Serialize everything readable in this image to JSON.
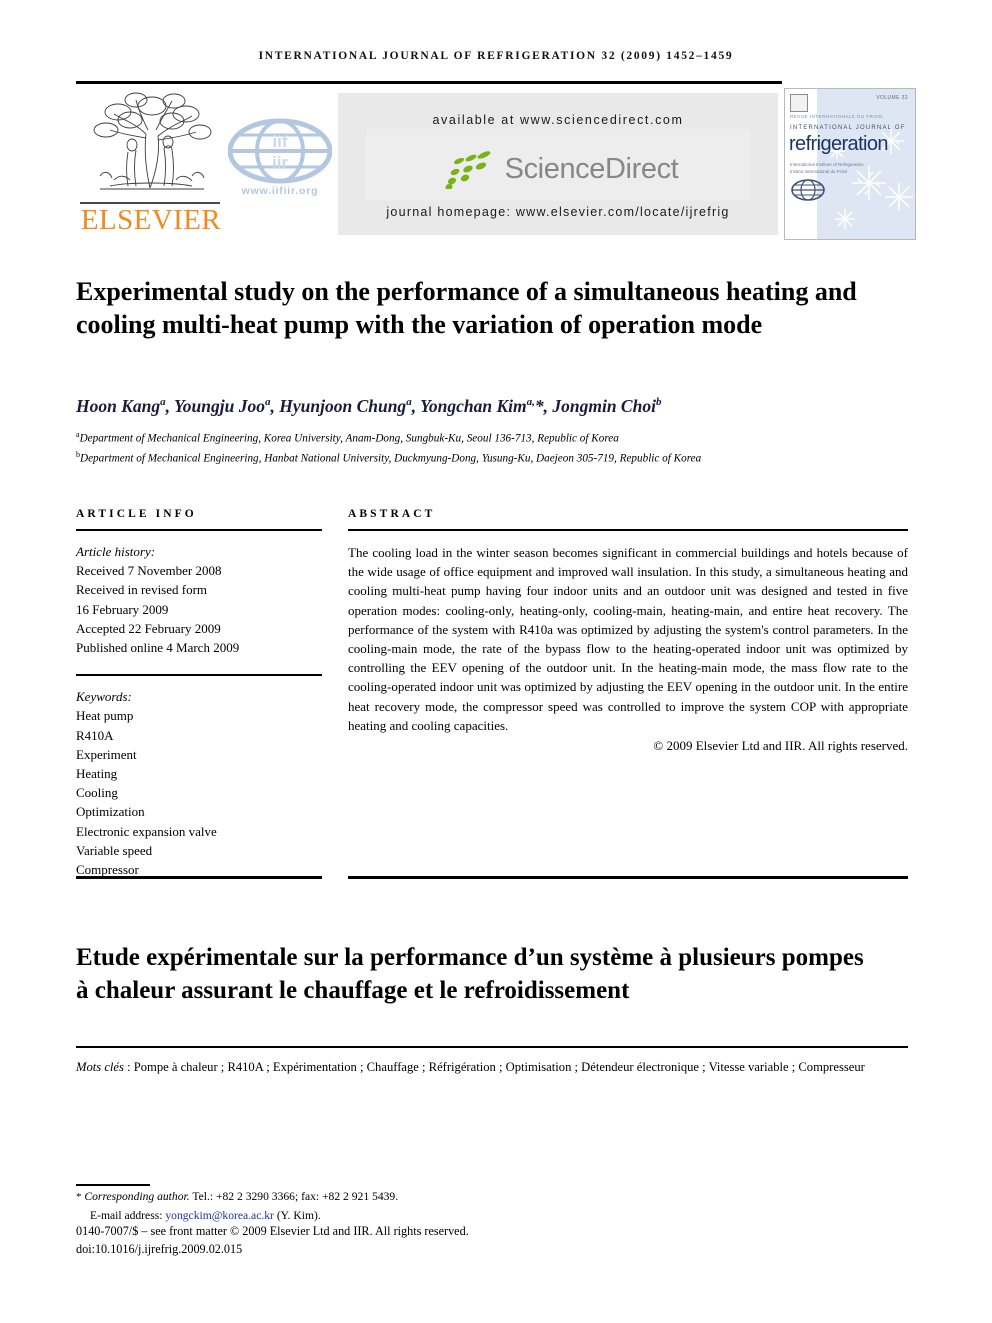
{
  "running_head": "International Journal of Refrigeration 32 (2009) 1452–1459",
  "header": {
    "elsevier_wordmark": "ELSEVIER",
    "iir_url": "www.iifiir.org",
    "iir_top_text": "iif",
    "iir_bottom_text": "iir",
    "available_at": "available at www.sciencedirect.com",
    "sciencedirect_wordmark": "ScienceDirect",
    "journal_homepage": "journal homepage: www.elsevier.com/locate/ijrefrig",
    "cover": {
      "volume": "VOLUME 32",
      "eyebrow": "REVUE INTERNATIONALE DU FROID",
      "kicker": "INTERNATIONAL JOURNAL OF",
      "title": "refrigeration",
      "subtitle_line1": "International Institute of Refrigeration",
      "subtitle_line2": "Institut International du Froid"
    }
  },
  "article": {
    "title": "Experimental study on the performance of a simultaneous heating and cooling multi-heat pump with the variation of operation mode",
    "authors_html": "Hoon Kang<sup>a</sup>, Youngju Joo<sup>a</sup>, Hyunjoon Chung<sup>a</sup>, Yongchan Kim<sup>a,</sup>*, Jongmin Choi<sup>b</sup>",
    "affiliation_a": "Department of Mechanical Engineering, Korea University, Anam-Dong, Sungbuk-Ku, Seoul 136-713, Republic of Korea",
    "affiliation_b": "Department of Mechanical Engineering, Hanbat National University, Duckmyung-Dong, Yusung-Ku, Daejeon 305-719, Republic of Korea"
  },
  "article_info": {
    "heading": "ARTICLE INFO",
    "history_label": "Article history:",
    "history": [
      "Received 7 November 2008",
      "Received in revised form",
      "16 February 2009",
      "Accepted 22 February 2009",
      "Published online 4 March 2009"
    ],
    "keywords_label": "Keywords:",
    "keywords": [
      "Heat pump",
      "R410A",
      "Experiment",
      "Heating",
      "Cooling",
      "Optimization",
      "Electronic expansion valve",
      "Variable speed",
      "Compressor"
    ]
  },
  "abstract": {
    "heading": "ABSTRACT",
    "text": "The cooling load in the winter season becomes significant in commercial buildings and hotels because of the wide usage of office equipment and improved wall insulation. In this study, a simultaneous heating and cooling multi-heat pump having four indoor units and an outdoor unit was designed and tested in five operation modes: cooling-only, heating-only, cooling-main, heating-main, and entire heat recovery. The performance of the system with R410a was optimized by adjusting the system's control parameters. In the cooling-main mode, the rate of the bypass flow to the heating-operated indoor unit was optimized by controlling the EEV opening of the outdoor unit. In the heating-main mode, the mass flow rate to the cooling-operated indoor unit was optimized by adjusting the EEV opening in the outdoor unit. In the entire heat recovery mode, the compressor speed was controlled to improve the system COP with appropriate heating and cooling capacities.",
    "copyright": "© 2009 Elsevier Ltd and IIR. All rights reserved."
  },
  "french": {
    "title": "Etude expérimentale sur la performance d’un système à plusieurs pompes à chaleur assurant le chauffage et le refroidissement",
    "keywords_label": "Mots clés",
    "keywords_text": " : Pompe à chaleur ; R410A ; Expérimentation ; Chauffage ; Réfrigération ; Optimisation ; Détendeur électronique ; Vitesse variable ; Compresseur"
  },
  "footer": {
    "corresponding_label": "Corresponding author.",
    "corresponding_contact": " Tel.: +82 2 3290 3366; fax: +82 2 921 5439.",
    "email_label": "E-mail address:",
    "email": "yongckim@korea.ac.kr",
    "email_suffix": "(Y. Kim).",
    "front_matter": "0140-7007/$ – see front matter © 2009 Elsevier Ltd and IIR. All rights reserved.",
    "doi": "doi:10.1016/j.ijrefrig.2009.02.015"
  },
  "colors": {
    "elsevier_orange": "#F08A21",
    "sciencedirect_green": "#7AB317",
    "sciencedirect_grey": "#878787",
    "iir_blue": "#b3c7e0",
    "link_blue": "#2330a8",
    "cover_blue": "#dde6f2"
  }
}
